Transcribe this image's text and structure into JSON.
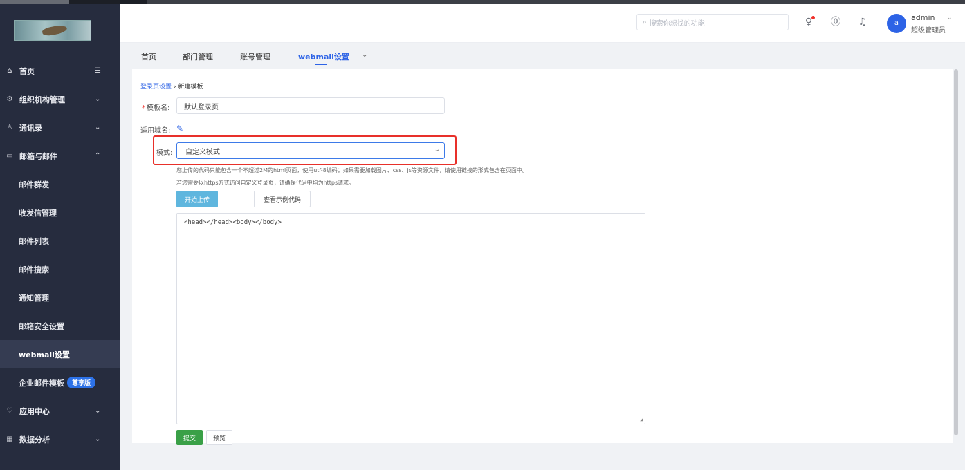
{
  "sidebar": {
    "items": [
      {
        "icon": "⌂",
        "label": "首页",
        "arrow": "☰"
      },
      {
        "icon": "⚙",
        "label": "组织机构管理",
        "arrow": "⌄"
      },
      {
        "icon": "♙",
        "label": "通讯录",
        "arrow": "⌄"
      },
      {
        "icon": "▭",
        "label": "邮箱与邮件",
        "arrow": "⌃"
      }
    ],
    "subitems": [
      "邮件群发",
      "收发信管理",
      "邮件列表",
      "邮件搜索",
      "通知管理",
      "邮箱安全设置",
      "webmail设置",
      "企业邮件模板"
    ],
    "badge": "尊享版",
    "bottom_items": [
      {
        "icon": "♡",
        "label": "应用中心",
        "arrow": "⌄"
      },
      {
        "icon": "▦",
        "label": "数据分析",
        "arrow": "⌄"
      }
    ]
  },
  "header": {
    "search_placeholder": "搜索你想找的功能",
    "user_name": "admin",
    "user_role": "超级管理员",
    "avatar_letter": "a"
  },
  "tabs": [
    "首页",
    "部门管理",
    "账号管理",
    "webmail设置"
  ],
  "form": {
    "breadcrumb_link": "登录页设置",
    "breadcrumb_sep": "›",
    "breadcrumb_current": "新建模板",
    "template_name_label": "模板名:",
    "template_name_value": "默认登录页",
    "domain_label": "适用域名:",
    "mode_label": "模式:",
    "mode_value": "自定义模式",
    "hint1": "您上传的代码只能包含一个不超过2M的html页面，使用utf-8编码；如果需要加载图片、css、js等资源文件，请使用链接的形式包含在页面中。",
    "hint2": "若您需要以https方式访问自定义登录页，请确保代码中均为https请求。",
    "upload_button": "开始上传",
    "example_button": "查看示例代码",
    "code_value": "<head></head><body></body>",
    "submit_button": "提交",
    "preview_button": "预览"
  }
}
